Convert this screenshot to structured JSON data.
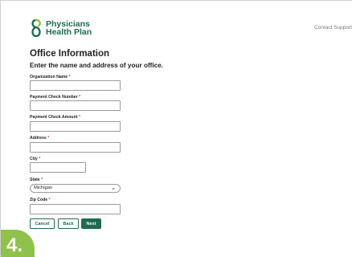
{
  "header": {
    "logo_line1": "Physicians",
    "logo_line2": "Health Plan",
    "contact_link": "Contact Support"
  },
  "page": {
    "title": "Office Information",
    "subtitle": "Enter the name and address of your office."
  },
  "form": {
    "required_mark": "*",
    "org_name_label": "Organization Name",
    "org_name_value": "",
    "check_number_label": "Payment Check Number",
    "check_number_value": "",
    "check_amount_label": "Payment Check Amount",
    "check_amount_value": "",
    "address_label": "Address",
    "address_value": "",
    "city_label": "City",
    "city_value": "",
    "state_label": "State",
    "state_value": "Michigan",
    "zip_label": "Zip Code",
    "zip_value": ""
  },
  "actions": {
    "cancel_label": "Cancel",
    "back_label": "Back",
    "next_label": "Next"
  },
  "step": {
    "number": "4."
  },
  "colors": {
    "brand_green": "#1e6b4f",
    "step_badge": "#8fc24a",
    "required": "#c0392b"
  }
}
